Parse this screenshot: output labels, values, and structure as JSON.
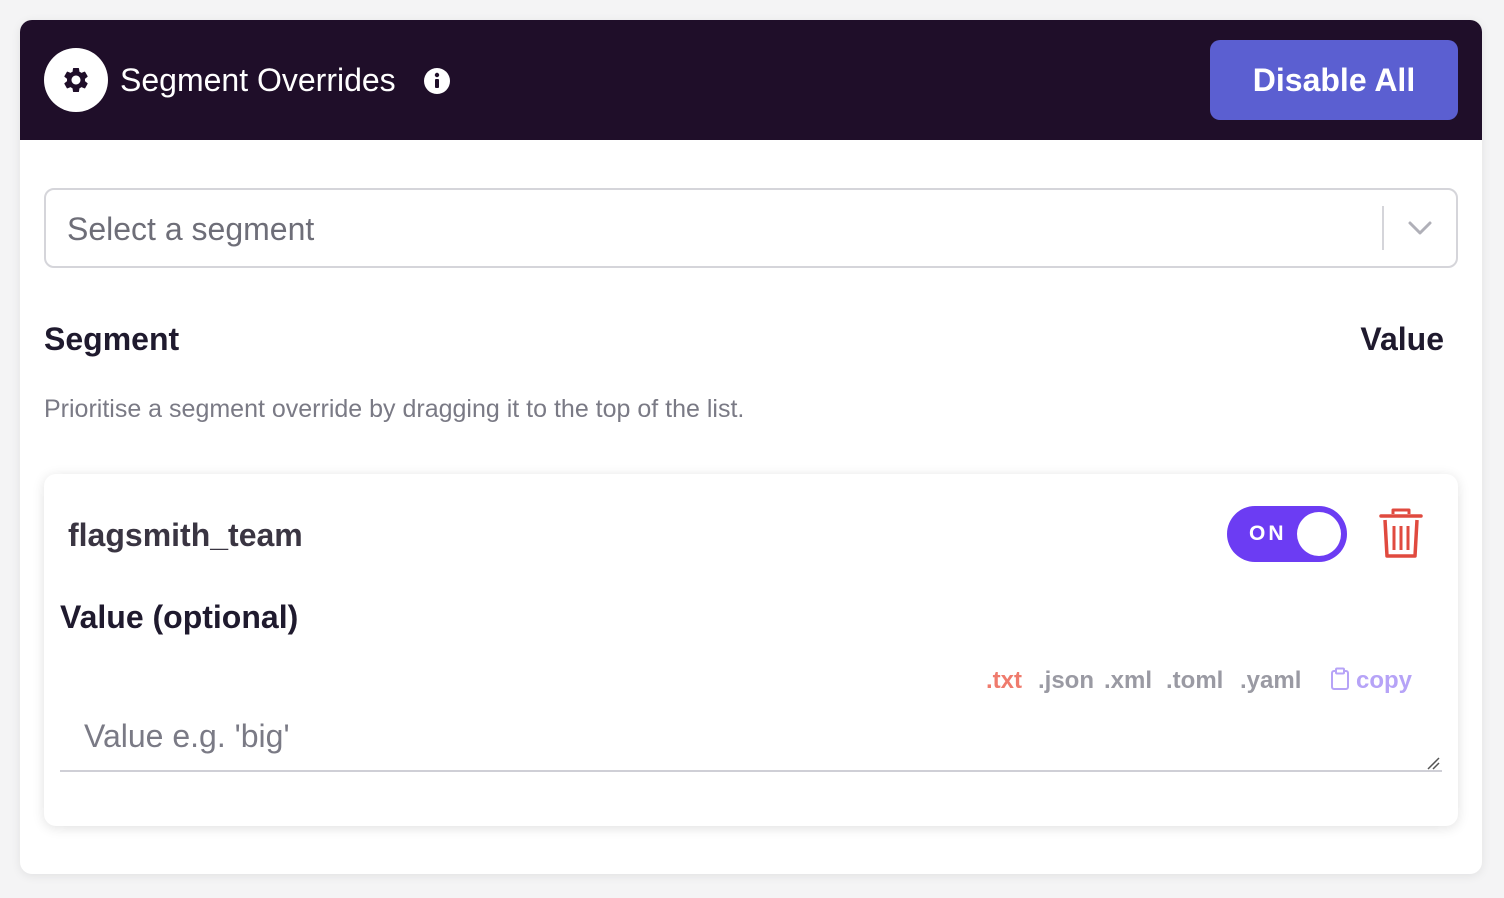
{
  "header": {
    "title": "Segment Overrides",
    "icon": "gear-icon",
    "info_icon": "info-icon",
    "disable_all_label": "Disable All",
    "background": "#1f0e29",
    "button_color": "#5b5fd1"
  },
  "segment_select": {
    "placeholder": "Select a segment",
    "icon": "chevron-down-icon"
  },
  "columns": {
    "segment": "Segment",
    "value": "Value"
  },
  "hint": "Prioritise a segment override by dragging it to the top of the list.",
  "overrides": [
    {
      "segment_name": "flagsmith_team",
      "toggle_label": "ON",
      "enabled": true,
      "toggle_color": "#6c3cf3",
      "delete_icon": "trash-icon",
      "value_label": "Value (optional)",
      "value_placeholder": "Value e.g. 'big'",
      "value": "",
      "formats": [
        ".txt",
        ".json",
        ".xml",
        ".toml",
        ".yaml"
      ],
      "active_format": ".txt",
      "copy_label": "copy",
      "copy_icon": "clipboard-icon"
    }
  ]
}
